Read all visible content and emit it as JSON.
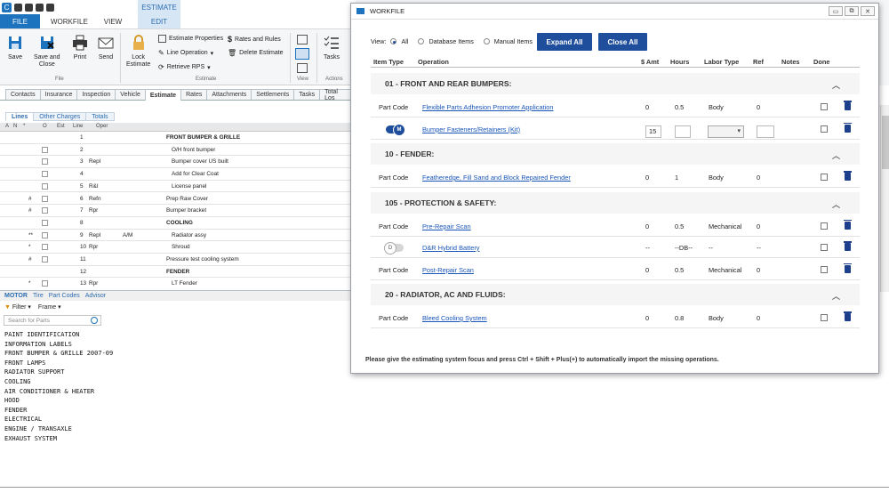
{
  "ribbon": {
    "context_label": "ESTIMATE",
    "tabs": [
      "FILE",
      "WORKFILE",
      "VIEW"
    ],
    "edit_tab": "EDIT",
    "buttons": {
      "save": "Save",
      "save_close_1": "Save and",
      "save_close_2": "Close",
      "print": "Print",
      "send": "Send",
      "lock_1": "Lock",
      "lock_2": "Estimate",
      "tasks": "Tasks"
    },
    "file_group": "File",
    "estimate_group": "Estimate",
    "view_group": "View",
    "actions_group": "Actions",
    "small": {
      "props": "Estimate Properties",
      "rates": "Rates and Rules",
      "line_op": "Line Operation",
      "delete": "Delete Estimate",
      "retrieve": "Retrieve RPS"
    }
  },
  "tabs": [
    "Contacts",
    "Insurance",
    "Inspection",
    "Vehicle",
    "Estimate",
    "Rates",
    "Attachments",
    "Settlements",
    "Tasks",
    "Total Los"
  ],
  "subtabs": [
    "Lines",
    "Other Charges",
    "Totals"
  ],
  "grid": {
    "headers": [
      "A",
      "N",
      "*",
      "O",
      "Est",
      "Line",
      "Oper"
    ],
    "rows": [
      {
        "mark": "",
        "line": "1",
        "oper": "",
        "desc": "FRONT BUMPER & GRILLE",
        "bold": true,
        "cb": false
      },
      {
        "mark": "",
        "line": "2",
        "oper": "",
        "desc": "O/H front bumper",
        "bold": false,
        "cb": true
      },
      {
        "mark": "",
        "line": "3",
        "oper": "Repl",
        "desc": "Bumper cover US built",
        "bold": false,
        "cb": true
      },
      {
        "mark": "",
        "line": "4",
        "oper": "",
        "desc": "Add for Clear Coat",
        "bold": false,
        "cb": true
      },
      {
        "mark": "",
        "line": "5",
        "oper": "R&I",
        "desc": "License panel",
        "bold": false,
        "cb": true
      },
      {
        "mark": "#",
        "line": "6",
        "oper": "Refn",
        "desc": "Prep Raw Cover",
        "bold": false,
        "cb": true
      },
      {
        "mark": "#",
        "line": "7",
        "oper": "Rpr",
        "desc": "Bumper bracket",
        "bold": false,
        "cb": true
      },
      {
        "mark": "",
        "line": "8",
        "oper": "",
        "desc": "COOLING",
        "bold": true,
        "cb": true
      },
      {
        "mark": "**",
        "line": "9",
        "oper": "Repl",
        "extra": "A/M",
        "desc": "Radiator assy",
        "bold": false,
        "cb": true
      },
      {
        "mark": "*",
        "line": "10",
        "oper": "Rpr",
        "desc": "Shroud",
        "bold": false,
        "cb": true
      },
      {
        "mark": "#",
        "line": "11",
        "oper": "",
        "desc": "Pressure test cooling system",
        "bold": false,
        "cb": true
      },
      {
        "mark": "",
        "line": "12",
        "oper": "",
        "desc": "FENDER",
        "bold": true,
        "cb": false
      },
      {
        "mark": "*",
        "line": "13",
        "oper": "Rpr",
        "desc": "LT Fender",
        "bold": false,
        "cb": true
      }
    ]
  },
  "motor": {
    "tabs": [
      "MOTOR",
      "Tire",
      "Part Codes",
      "Advisor"
    ],
    "filter": "Filter",
    "frame": "Frame",
    "search_placeholder": "Search for Parts",
    "parts": [
      "PAINT IDENTIFICATION",
      "INFORMATION LABELS",
      "FRONT BUMPER & GRILLE 2007-09",
      "FRONT LAMPS",
      "RADIATOR SUPPORT",
      "COOLING",
      "AIR CONDITIONER & HEATER",
      "HOOD",
      "FENDER",
      "ELECTRICAL",
      "ENGINE / TRANSAXLE",
      "EXHAUST SYSTEM"
    ]
  },
  "workfile": {
    "title": "WORKFILE",
    "view_label": "View:",
    "view_options": [
      "All",
      "Database Items",
      "Manual Items"
    ],
    "expand_all": "Expand All",
    "close_all": "Close All",
    "columns": [
      "Item Type",
      "Operation",
      "$ Amt",
      "Hours",
      "Labor Type",
      "Ref",
      "Notes",
      "Done"
    ],
    "sections": [
      {
        "title": "01 - FRONT AND REAR BUMPERS:",
        "rows": [
          {
            "type": "Part Code",
            "op": "Flexible Parts Adhesion Promoter Application",
            "amt": "0",
            "hours": "0.5",
            "labor": "Body",
            "ref": "0"
          },
          {
            "type": "",
            "toggle": "M",
            "op": "Bumper Fasteners/Retainers (Kit)",
            "amt": "15",
            "hours": "",
            "labor": "",
            "ref": "",
            "editable": true
          }
        ]
      },
      {
        "title": "10 - FENDER:",
        "rows": [
          {
            "type": "Part Code",
            "op": "Featheredge, Fill Sand and Block Repaired Fender",
            "amt": "0",
            "hours": "1",
            "labor": "Body",
            "ref": "0"
          }
        ]
      },
      {
        "title": "105 - PROTECTION & SAFETY:",
        "rows": [
          {
            "type": "Part Code",
            "op": "Pre-Repair Scan",
            "amt": "0",
            "hours": "0.5",
            "labor": "Mechanical",
            "ref": "0"
          },
          {
            "type": "",
            "toggle": "D",
            "op": "D&R Hybrid Battery",
            "amt": "--",
            "hours": "--DB--",
            "labor": "--",
            "ref": "--"
          },
          {
            "type": "Part Code",
            "op": "Post-Repair Scan",
            "amt": "0",
            "hours": "0.5",
            "labor": "Mechanical",
            "ref": "0"
          }
        ]
      },
      {
        "title": "20 - RADIATOR, AC AND FLUIDS:",
        "rows": [
          {
            "type": "Part Code",
            "op": "Bleed Cooling System",
            "amt": "0",
            "hours": "0.8",
            "labor": "Body",
            "ref": "0"
          }
        ]
      }
    ],
    "footnote": "Please give the estimating system focus and press Ctrl + Shift + Plus(+) to automatically import the missing operations."
  }
}
